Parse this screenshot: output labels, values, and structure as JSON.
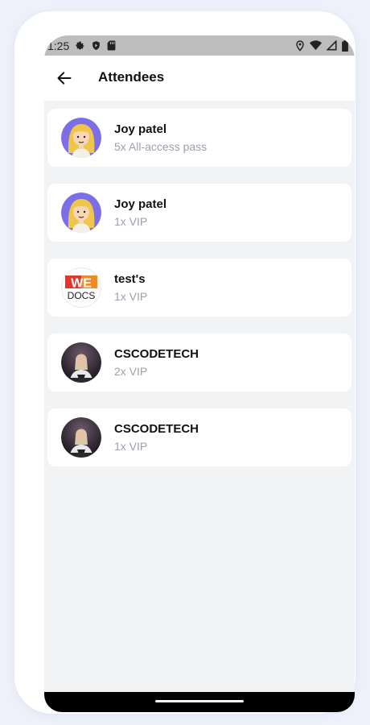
{
  "status_bar": {
    "time": "1:25",
    "left_icons": [
      "gear-icon",
      "shield-icon",
      "sd-card-icon"
    ],
    "right_icons": [
      "location-icon",
      "wifi-icon",
      "signal-icon",
      "battery-icon"
    ]
  },
  "header": {
    "back_icon": "arrow-left-icon",
    "title": "Attendees"
  },
  "attendees": [
    {
      "name": "Joy patel",
      "ticket": "5x All-access pass",
      "avatar": "cartoon-girl"
    },
    {
      "name": "Joy patel",
      "ticket": "1x VIP",
      "avatar": "cartoon-girl"
    },
    {
      "name": "test's",
      "ticket": "1x VIP",
      "avatar": "logo"
    },
    {
      "name": "CSCODETECH",
      "ticket": "2x VIP",
      "avatar": "photo"
    },
    {
      "name": "CSCODETECH",
      "ticket": "1x VIP",
      "avatar": "photo"
    }
  ],
  "logo_text": {
    "top": "WE",
    "bottom": "DOCS"
  },
  "colors": {
    "background": "#f2f3f5",
    "card": "#ffffff",
    "name": "#111111",
    "ticket": "#9aa0ad",
    "avatar_purple": "#7b6ee6"
  }
}
